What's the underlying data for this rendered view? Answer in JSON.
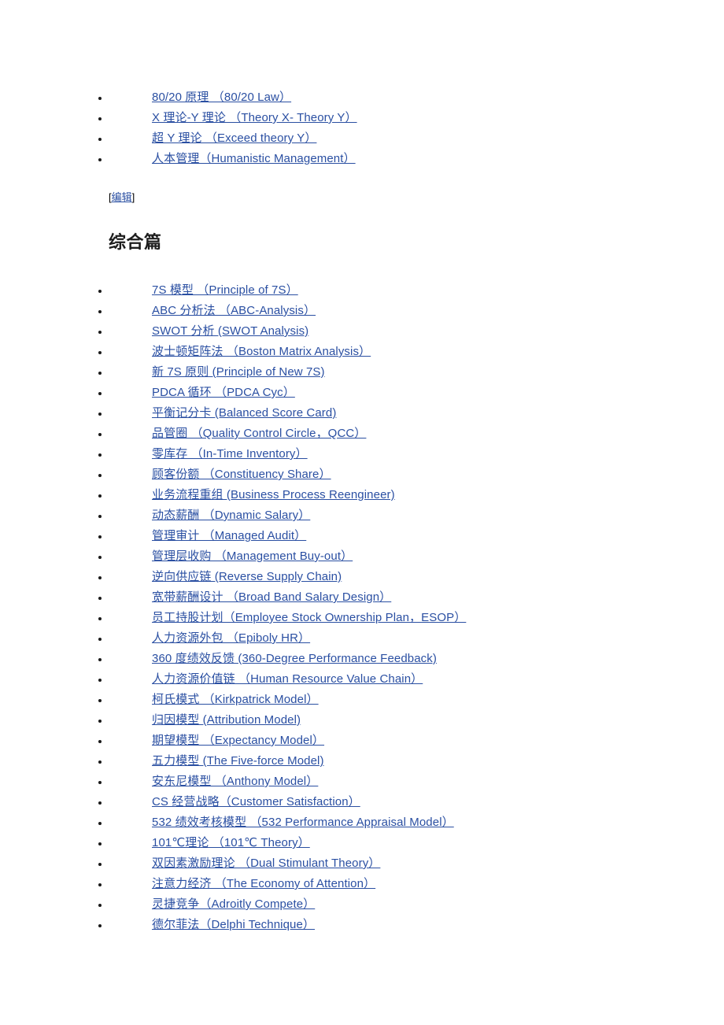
{
  "document": {
    "theory_list": [
      "80/20 原理 （80/20 Law）",
      "X 理论-Y 理论 （Theory X- Theory Y）",
      "超 Y 理论 （Exceed theory Y）",
      "人本管理（Humanistic Management）"
    ],
    "edit_marker": {
      "open_bracket": "[",
      "label": "编辑",
      "close_bracket": "]"
    },
    "section_title": "综合篇",
    "comprehensive_list": [
      "7S 模型 （Principle of 7S）",
      "ABC 分析法 （ABC-Analysis）",
      "SWOT 分析 (SWOT Analysis)",
      "波士顿矩阵法 （Boston Matrix Analysis）",
      "新 7S 原则 (Principle of New 7S)",
      "PDCA 循环 （PDCA Cyc）",
      "平衡记分卡 (Balanced Score Card)",
      "品管圈 （Quality Control Circle，QCC）",
      "零库存 （In-Time Inventory）",
      "顾客份额 （Constituency Share）",
      "业务流程重组 (Business Process Reengineer)",
      "动态薪酬 （Dynamic Salary）",
      "管理审计 （Managed Audit）",
      "管理层收购 （Management Buy-out）",
      "逆向供应链 (Reverse Supply Chain)",
      "宽带薪酬设计 （Broad Band Salary Design）",
      "员工持股计划（Employee Stock Ownership Plan，ESOP）",
      "人力资源外包 （Epiboly HR）",
      "360 度绩效反馈 (360-Degree Performance Feedback)",
      "人力资源价值链 （Human Resource Value Chain）",
      "柯氏模式 （Kirkpatrick Model）",
      "归因模型 (Attribution Model)",
      "期望模型 （Expectancy Model）",
      "五力模型 (The Five-force Model)",
      "安东尼模型 （Anthony Model）",
      "CS 经营战略（Customer Satisfaction）",
      "532 绩效考核模型 （532 Performance Appraisal Model）",
      "101℃理论 （101℃ Theory）",
      "双因素激励理论 （Dual Stimulant Theory）",
      "注意力经济 （The Economy of Attention）",
      "灵捷竞争（Adroitly Compete）",
      "德尔菲法（Delphi Technique）"
    ]
  },
  "colors": {
    "link": "#2a4fa2",
    "heading": "#1d1d1d",
    "background": "#ffffff"
  }
}
